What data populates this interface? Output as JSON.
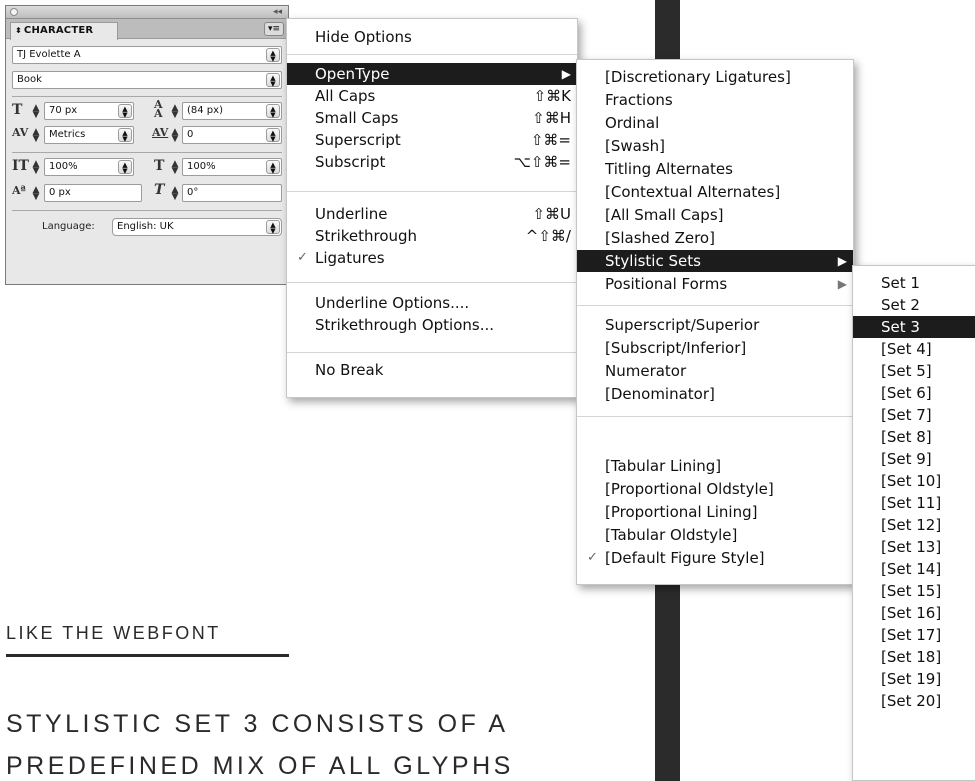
{
  "character_panel": {
    "tab_title": "CHARACTER",
    "font_family": "TJ Evolette A",
    "font_style": "Book",
    "font_size": "70 px",
    "leading": "(84 px)",
    "kerning": "Metrics",
    "tracking": "0",
    "vertical_scale": "100%",
    "horizontal_scale": "100%",
    "baseline_shift": "0 px",
    "skew": "0°",
    "language_label": "Language:",
    "language_value": "English: UK"
  },
  "main_menu": {
    "items": [
      {
        "label": "Hide Options"
      },
      {
        "label": "OpenType"
      },
      {
        "label": "All Caps",
        "shortcut": "⇧⌘K"
      },
      {
        "label": "Small Caps",
        "shortcut": "⇧⌘H"
      },
      {
        "label": "Superscript",
        "shortcut": "⇧⌘="
      },
      {
        "label": "Subscript",
        "shortcut": "⌥⇧⌘="
      },
      {
        "label": "Underline",
        "shortcut": "⇧⌘U"
      },
      {
        "label": "Strikethrough",
        "shortcut": "^⇧⌘/"
      },
      {
        "label": "Ligatures"
      },
      {
        "label": "Underline Options...."
      },
      {
        "label": "Strikethrough Options..."
      },
      {
        "label": "No Break"
      }
    ]
  },
  "opentype_menu": {
    "items": [
      {
        "label": "[Discretionary Ligatures]"
      },
      {
        "label": "Fractions"
      },
      {
        "label": "Ordinal"
      },
      {
        "label": "[Swash]"
      },
      {
        "label": "Titling Alternates"
      },
      {
        "label": "[Contextual Alternates]"
      },
      {
        "label": "[All Small Caps]"
      },
      {
        "label": "[Slashed Zero]"
      },
      {
        "label": "Stylistic Sets"
      },
      {
        "label": "Positional Forms"
      },
      {
        "label": "Superscript/Superior"
      },
      {
        "label": "[Subscript/Inferior]"
      },
      {
        "label": "Numerator"
      },
      {
        "label": "[Denominator]"
      },
      {
        "label": "[Tabular Lining]"
      },
      {
        "label": "[Proportional Oldstyle]"
      },
      {
        "label": "[Proportional Lining]"
      },
      {
        "label": "[Tabular Oldstyle]"
      },
      {
        "label": "[Default Figure Style]"
      }
    ]
  },
  "stylistic_sets_menu": {
    "items": [
      {
        "label": "Set 1"
      },
      {
        "label": "Set 2"
      },
      {
        "label": "Set 3"
      },
      {
        "label": "[Set 4]"
      },
      {
        "label": "[Set 5]"
      },
      {
        "label": "[Set 6]"
      },
      {
        "label": "[Set 7]"
      },
      {
        "label": "[Set 8]"
      },
      {
        "label": "[Set 9]"
      },
      {
        "label": "[Set 10]"
      },
      {
        "label": "[Set 11]"
      },
      {
        "label": "[Set 12]"
      },
      {
        "label": "[Set 13]"
      },
      {
        "label": "[Set 14]"
      },
      {
        "label": "[Set 15]"
      },
      {
        "label": "[Set 16]"
      },
      {
        "label": "[Set 17]"
      },
      {
        "label": "[Set 18]"
      },
      {
        "label": "[Set 19]"
      },
      {
        "label": "[Set 20]"
      }
    ]
  },
  "article": {
    "heading": "LIKE THE WEBFONT",
    "body": "STYLISTIC SET 3 CONSISTS OF A PREDEFINED MIX OF ALL GLYPHS"
  }
}
